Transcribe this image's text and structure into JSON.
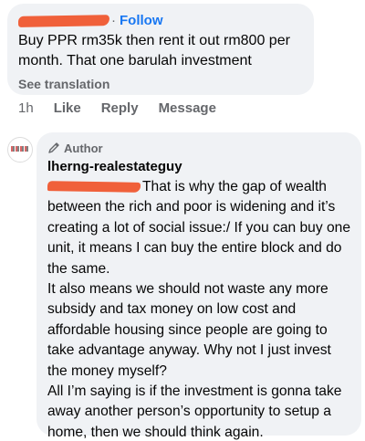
{
  "comment1": {
    "follow_label": "Follow",
    "text": "Buy PPR rm35k then rent it out rm800 per month. That one barulah investment",
    "see_translation": "See translation"
  },
  "actions": {
    "time": "1h",
    "like": "Like",
    "reply": "Reply",
    "message": "Message"
  },
  "comment2": {
    "author_badge": "Author",
    "username": "lherng-realestateguy",
    "paragraph1": "That is why the gap of wealth between the rich and poor is widening and it’s creating a lot of social issue:/ If you can buy one unit, it means I can buy the entire block and do the same.",
    "paragraph2": "It also means we should not waste any more subsidy and tax money on low cost and affordable housing since people are going to take advantage anyway. Why not I just invest the money myself?",
    "paragraph3": "All I’m saying is if the investment is gonna take away another person’s opportunity to setup a home, then we should think again."
  },
  "colors": {
    "link_blue": "#1877f2",
    "bubble_bg": "#f0f2f5",
    "redaction": "#f0603a",
    "muted_text": "#65676b"
  }
}
